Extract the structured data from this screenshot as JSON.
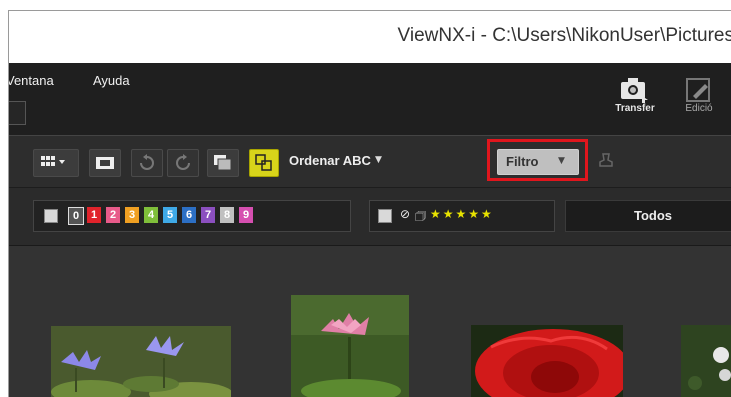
{
  "window": {
    "title": "ViewNX-i - C:\\Users\\NikonUser\\Pictures"
  },
  "menu": {
    "items": [
      "Ventana",
      "Ayuda"
    ]
  },
  "tools": {
    "transfer_label": "Transfer",
    "edit_label": "Edició"
  },
  "toolbar": {
    "sort_label": "Ordenar ABC",
    "filter_label": "Filtro",
    "highlight_color": "#e0161d"
  },
  "filterbar": {
    "label_numbers": [
      "0",
      "1",
      "2",
      "3",
      "4",
      "5",
      "6",
      "7",
      "8",
      "9"
    ],
    "label_colors": [
      "#8a8a8a",
      "#e1232b",
      "#e85b8a",
      "#f0a022",
      "#7fbf3a",
      "#3fa9e6",
      "#2c6fc4",
      "#8b4fbf",
      "#c0c0c0",
      "#d64fb0"
    ],
    "stars": "★★★★★",
    "all_label": "Todos"
  }
}
